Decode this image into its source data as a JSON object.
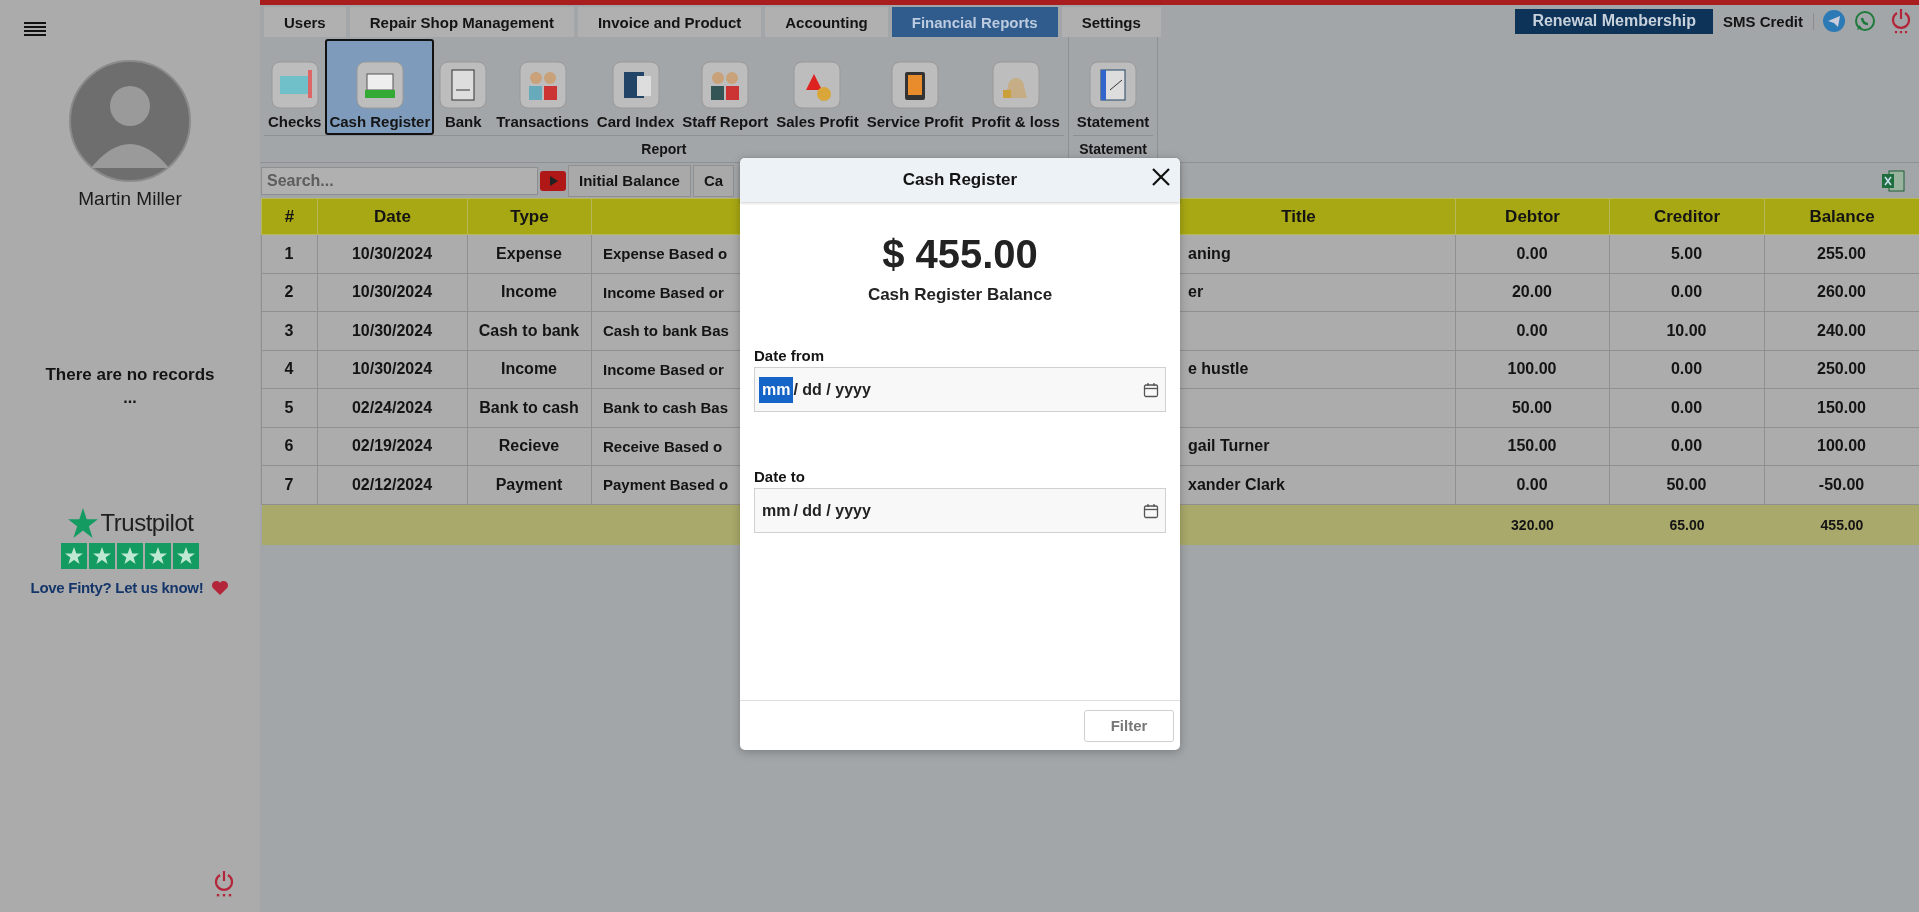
{
  "sidebar": {
    "user_name": "Martin Miller",
    "empty_message": "There are no records",
    "empty_ellipsis": "...",
    "trustpilot": {
      "brand": "Trustpilot",
      "stars": 5,
      "cta": "Love Finty? Let us know!"
    }
  },
  "tabs": [
    {
      "label": "Users",
      "selected": false
    },
    {
      "label": "Repair Shop Management",
      "selected": false
    },
    {
      "label": "Invoice and Product",
      "selected": false
    },
    {
      "label": "Accounting",
      "selected": false
    },
    {
      "label": "Financial Reports",
      "selected": true
    },
    {
      "label": "Settings",
      "selected": false
    }
  ],
  "header_actions": {
    "renewal_button": "Renewal Membership",
    "sms_credit": "SMS Credit"
  },
  "ribbon": {
    "groups": [
      {
        "label": "Report",
        "items": [
          {
            "label": "Checks",
            "selected": false
          },
          {
            "label": "Cash Register",
            "selected": true
          },
          {
            "label": "Bank",
            "selected": false
          },
          {
            "label": "Transactions",
            "selected": false
          },
          {
            "label": "Card Index",
            "selected": false
          },
          {
            "label": "Staff Report",
            "selected": false
          },
          {
            "label": "Sales Profit",
            "selected": false
          },
          {
            "label": "Service Profit",
            "selected": false
          },
          {
            "label": "Profit & loss",
            "selected": false
          }
        ]
      },
      {
        "label": "Statement",
        "items": [
          {
            "label": "Statement",
            "selected": false
          }
        ]
      }
    ]
  },
  "toolbar": {
    "search": {
      "placeholder": "Search..."
    },
    "buttons": [
      "Initial Balance",
      "Ca"
    ]
  },
  "table": {
    "columns": {
      "num": "#",
      "date": "Date",
      "type": "Type",
      "title": "Title",
      "debtor": "Debtor",
      "creditor": "Creditor",
      "balance": "Balance"
    },
    "rows": [
      {
        "num": "1",
        "date": "10/30/2024",
        "type": "Expense",
        "column_4": "Expense Based o",
        "title": "aning",
        "debtor": "0.00",
        "creditor": "5.00",
        "balance": "255.00"
      },
      {
        "num": "2",
        "date": "10/30/2024",
        "type": "Income",
        "column_4": "Income Based or",
        "title": "er",
        "debtor": "20.00",
        "creditor": "0.00",
        "balance": "260.00"
      },
      {
        "num": "3",
        "date": "10/30/2024",
        "type": "Cash to bank",
        "column_4": "Cash to bank Bas",
        "debtor": "0.00",
        "creditor": "10.00",
        "balance": "240.00"
      },
      {
        "num": "4",
        "date": "10/30/2024",
        "type": "Income",
        "column_4": "Income Based or",
        "title": "e hustle",
        "debtor": "100.00",
        "creditor": "0.00",
        "balance": "250.00"
      },
      {
        "num": "5",
        "date": "02/24/2024",
        "type": "Bank to cash",
        "column_4": "Bank to cash Bas",
        "debtor": "50.00",
        "creditor": "0.00",
        "balance": "150.00"
      },
      {
        "num": "6",
        "date": "02/19/2024",
        "type": "Recieve",
        "column_4": "Receive Based o",
        "title": "gail Turner",
        "debtor": "150.00",
        "creditor": "0.00",
        "balance": "100.00"
      },
      {
        "num": "7",
        "date": "02/12/2024",
        "type": "Payment",
        "column_4": "Payment Based o",
        "title": "xander Clark",
        "debtor": "0.00",
        "creditor": "50.00",
        "balance": "-50.00"
      }
    ],
    "totals": {
      "debtor": "320.00",
      "creditor": "65.00",
      "balance": "455.00"
    }
  },
  "modal": {
    "title": "Cash Register",
    "amount": "$ 455.00",
    "amount_label": "Cash Register Balance",
    "fields": [
      {
        "label": "Date from",
        "placeholder": "mm / dd / yyyy",
        "focused": true
      },
      {
        "label": "Date to",
        "placeholder": "mm / dd / yyyy",
        "focused": false
      }
    ],
    "filter_button": "Filter"
  }
}
